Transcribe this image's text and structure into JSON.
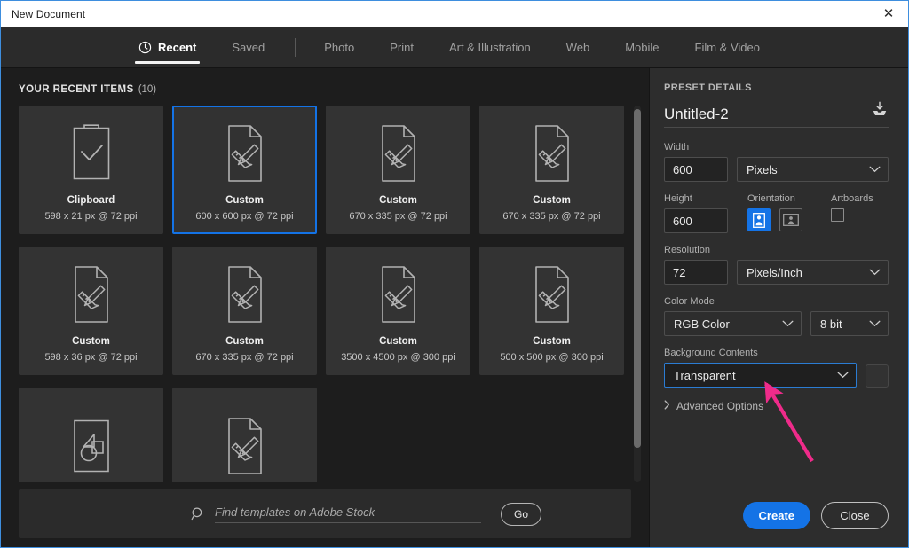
{
  "window": {
    "title": "New Document",
    "close_icon": "close-icon",
    "accent_color": "#1473e6",
    "annotation_color": "#ef2b8a"
  },
  "tabs": [
    {
      "label": "Recent",
      "icon": "clock-icon",
      "active": true
    },
    {
      "label": "Saved",
      "active": false
    },
    {
      "label": "Photo",
      "active": false
    },
    {
      "label": "Print",
      "active": false
    },
    {
      "label": "Art & Illustration",
      "active": false
    },
    {
      "label": "Web",
      "active": false
    },
    {
      "label": "Mobile",
      "active": false
    },
    {
      "label": "Film & Video",
      "active": false
    }
  ],
  "recent": {
    "heading": "YOUR RECENT ITEMS",
    "count": "(10)",
    "items": [
      {
        "title": "Clipboard",
        "subtitle": "598 x 21 px @ 72 ppi",
        "icon": "clipboard-check-icon",
        "selected": false
      },
      {
        "title": "Custom",
        "subtitle": "600 x 600 px @ 72 ppi",
        "icon": "document-pencil-ruler-icon",
        "selected": true
      },
      {
        "title": "Custom",
        "subtitle": "670 x 335 px @ 72 ppi",
        "icon": "document-pencil-ruler-icon",
        "selected": false
      },
      {
        "title": "Custom",
        "subtitle": "670 x 335 px @ 72 ppi",
        "icon": "document-pencil-ruler-icon",
        "selected": false
      },
      {
        "title": "Custom",
        "subtitle": "598 x 36 px @ 72 ppi",
        "icon": "document-pencil-ruler-icon",
        "selected": false
      },
      {
        "title": "Custom",
        "subtitle": "670 x 335 px @ 72 ppi",
        "icon": "document-pencil-ruler-icon",
        "selected": false
      },
      {
        "title": "Custom",
        "subtitle": "3500 x 4500 px @ 300 ppi",
        "icon": "document-pencil-ruler-icon",
        "selected": false
      },
      {
        "title": "Custom",
        "subtitle": "500 x 500 px @ 300 ppi",
        "icon": "document-pencil-ruler-icon",
        "selected": false
      },
      {
        "title": "",
        "subtitle": "",
        "icon": "artboard-shapes-icon",
        "selected": false
      },
      {
        "title": "",
        "subtitle": "",
        "icon": "document-pencil-ruler-icon",
        "selected": false
      }
    ]
  },
  "stock": {
    "search_icon": "search-icon",
    "placeholder": "Find templates on Adobe Stock",
    "value": "",
    "go_label": "Go"
  },
  "preset": {
    "heading": "PRESET DETAILS",
    "name_value": "Untitled-2",
    "save_preset_icon": "save-preset-icon",
    "width": {
      "label": "Width",
      "value": "600",
      "unit": "Pixels"
    },
    "height": {
      "label": "Height",
      "value": "600"
    },
    "orientation": {
      "label": "Orientation",
      "portrait_icon": "portrait-orientation-icon",
      "landscape_icon": "landscape-orientation-icon",
      "selected": "portrait"
    },
    "artboards": {
      "label": "Artboards",
      "checked": false
    },
    "resolution": {
      "label": "Resolution",
      "value": "72",
      "unit": "Pixels/Inch"
    },
    "color_mode": {
      "label": "Color Mode",
      "value": "RGB Color",
      "depth": "8 bit"
    },
    "background": {
      "label": "Background Contents",
      "value": "Transparent",
      "swatch_color": "#323232",
      "focused": true
    },
    "advanced": {
      "label": "Advanced Options",
      "chevron_icon": "chevron-right-icon",
      "expanded": false
    }
  },
  "footer": {
    "create_label": "Create",
    "close_label": "Close"
  },
  "scrollbar": {
    "name": "recent-items-scrollbar"
  }
}
